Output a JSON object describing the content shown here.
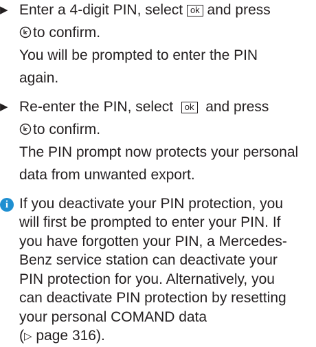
{
  "steps": [
    {
      "line1_pre": "Enter a 4-digit PIN, select",
      "line1_post": "and press",
      "line2": "to confirm.",
      "result1": "You will be prompted to enter the PIN",
      "result2": "again."
    },
    {
      "line1_pre": "Re-enter the PIN, select",
      "line1_post": "and press",
      "line2": "to confirm.",
      "result1": "The PIN prompt now protects your personal",
      "result2": "data from unwanted export."
    }
  ],
  "ok_label": "ok",
  "note": {
    "icon": "info-icon",
    "lines": [
      "If you deactivate your PIN protection, you",
      "will first be prompted to enter your PIN. If",
      "you have forgotten your PIN, a Mercedes-",
      "Benz service station can deactivate your",
      "PIN protection for you. Alternatively, you",
      "can deactivate PIN protection by resetting",
      "your personal COMAND data"
    ],
    "page_ref": "page 316)."
  },
  "colors": {
    "text": "#231f20",
    "info_icon": "#1f8fd1"
  }
}
